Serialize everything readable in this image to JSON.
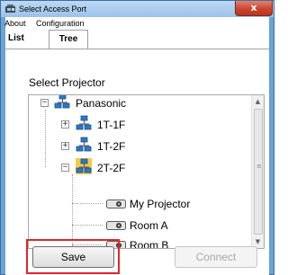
{
  "window": {
    "title": "Select Access Port",
    "close_label": "x"
  },
  "menu": {
    "items": [
      "About",
      "Configuration"
    ]
  },
  "tabs": [
    {
      "label": "List",
      "selected": false
    },
    {
      "label": "Tree",
      "selected": true
    }
  ],
  "main": {
    "select_label": "Select Projector"
  },
  "tree": {
    "root": {
      "label": "Panasonic",
      "expanded": true
    },
    "groups": [
      {
        "label": "1T-1F",
        "expanded": false
      },
      {
        "label": "1T-2F",
        "expanded": false
      },
      {
        "label": "2T-2F",
        "expanded": true
      }
    ],
    "projectors": [
      "My Projector",
      "Room A",
      "Room B"
    ],
    "expand_symbol": "+",
    "collapse_symbol": "−"
  },
  "buttons": {
    "save": "Save",
    "connect": "Connect"
  },
  "colors": {
    "highlight": "#e0262b",
    "title_gradient_top": "#bcd8f3",
    "close_button": "#c8422c"
  },
  "icons": {
    "network": "network-computers-icon",
    "projector": "projector-icon",
    "app": "app-icon"
  }
}
